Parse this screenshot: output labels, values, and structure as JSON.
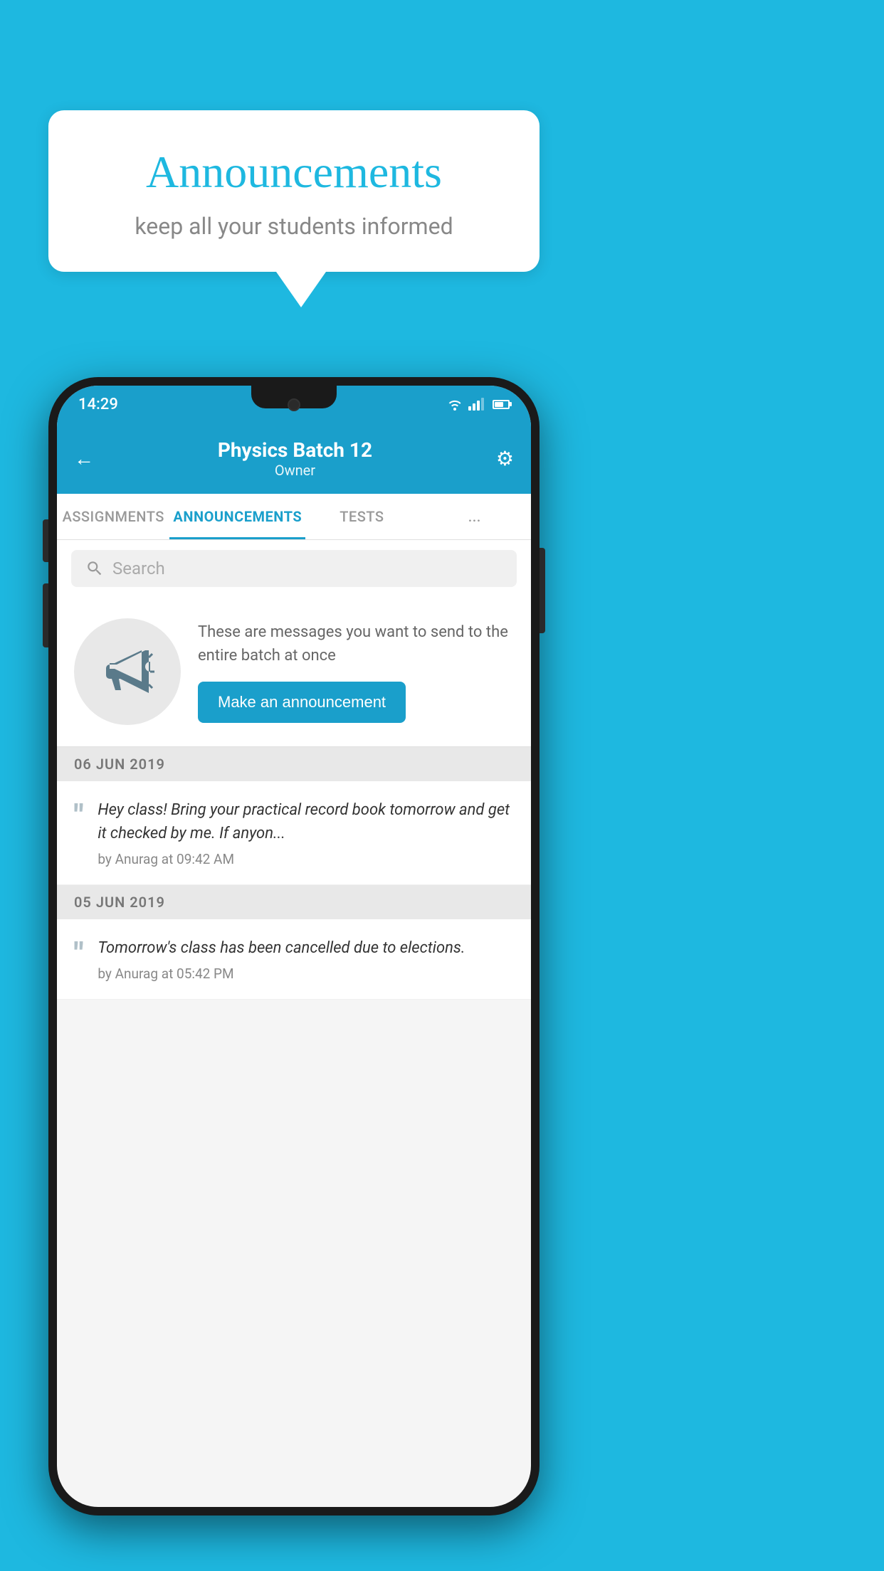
{
  "background_color": "#1eb8e0",
  "speech_bubble": {
    "title": "Announcements",
    "subtitle": "keep all your students informed"
  },
  "phone": {
    "status_bar": {
      "time": "14:29"
    },
    "header": {
      "title": "Physics Batch 12",
      "subtitle": "Owner",
      "back_label": "←",
      "gear_label": "⚙"
    },
    "tabs": [
      {
        "label": "ASSIGNMENTS",
        "active": false
      },
      {
        "label": "ANNOUNCEMENTS",
        "active": true
      },
      {
        "label": "TESTS",
        "active": false
      },
      {
        "label": "...",
        "active": false
      }
    ],
    "search": {
      "placeholder": "Search"
    },
    "promo": {
      "description": "These are messages you want to send to the entire batch at once",
      "button_label": "Make an announcement"
    },
    "announcements": [
      {
        "date": "06  JUN  2019",
        "text": "Hey class! Bring your practical record book tomorrow and get it checked by me. If anyon...",
        "meta": "by Anurag at 09:42 AM"
      },
      {
        "date": "05  JUN  2019",
        "text": "Tomorrow's class has been cancelled due to elections.",
        "meta": "by Anurag at 05:42 PM"
      }
    ]
  }
}
